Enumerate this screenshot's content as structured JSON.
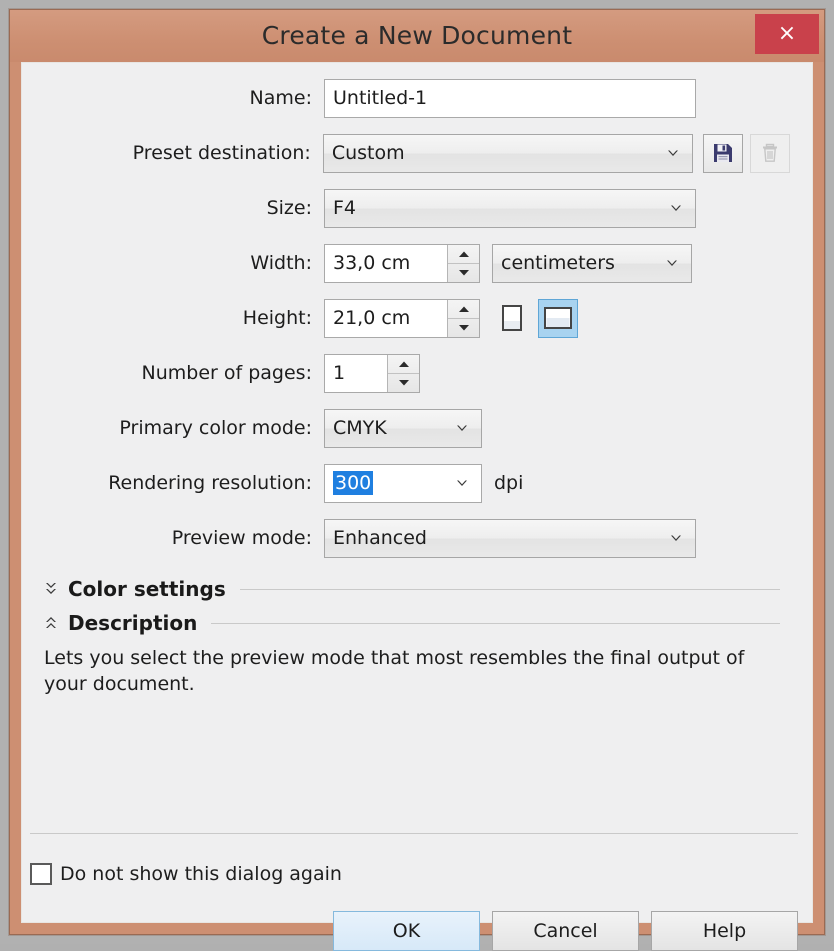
{
  "window": {
    "title": "Create a New Document",
    "close_label": "×",
    "close_icon": "close-icon",
    "accent_titlebar": "#cd8f72",
    "accent_close": "#c9414b",
    "client_bg": "#efeff0"
  },
  "form": {
    "name": {
      "label": "Name:",
      "value": "Untitled-1"
    },
    "preset_destination": {
      "label": "Preset destination:",
      "value": "Custom",
      "save_icon": "floppy-save-icon",
      "delete_icon": "trash-delete-icon",
      "delete_disabled": true
    },
    "size": {
      "label": "Size:",
      "value": "F4"
    },
    "width": {
      "label": "Width:",
      "value": "33,0 cm",
      "units_value": "centimeters"
    },
    "height": {
      "label": "Height:",
      "value": "21,0 cm",
      "orientation_portrait_icon": "page-portrait-icon",
      "orientation_landscape_icon": "page-landscape-icon",
      "orientation_selected": "landscape"
    },
    "number_of_pages": {
      "label": "Number of pages:",
      "value": "1"
    },
    "primary_color_mode": {
      "label": "Primary color mode:",
      "value": "CMYK"
    },
    "rendering_resolution": {
      "label": "Rendering resolution:",
      "value": "300",
      "unit": "dpi",
      "selected": true,
      "selection_color": "#1f7fe0"
    },
    "preview_mode": {
      "label": "Preview mode:",
      "value": "Enhanced"
    }
  },
  "sections": {
    "color_settings": {
      "title": "Color settings",
      "state": "collapsed",
      "chevron_icon": "chevron-double-down-icon"
    },
    "description": {
      "title": "Description",
      "state": "expanded",
      "chevron_icon": "chevron-double-up-icon",
      "body": "Lets you select the preview mode that most resembles the final output of your document."
    }
  },
  "footer": {
    "dont_show_checkbox": {
      "label": "Do not show this dialog again",
      "checked": false
    },
    "buttons": {
      "ok": "OK",
      "cancel": "Cancel",
      "help": "Help"
    }
  }
}
